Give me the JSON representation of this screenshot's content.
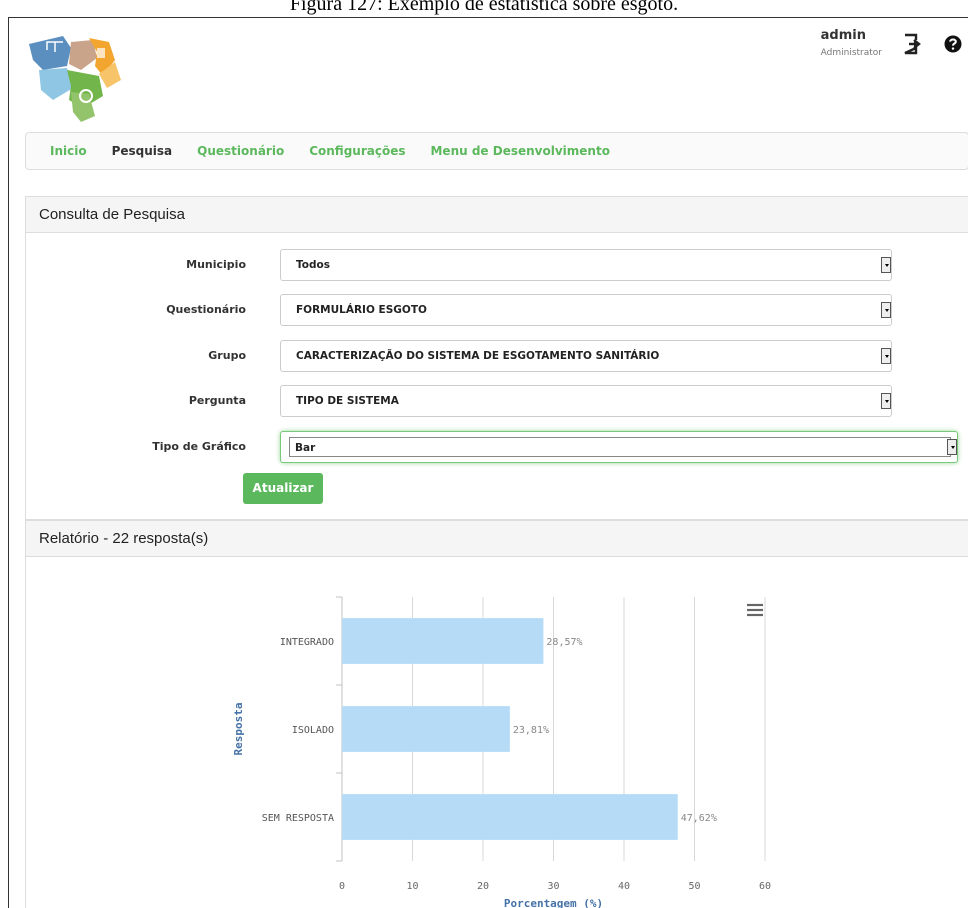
{
  "caption": "Figura 127: Exemplo de estatística sobre esgoto.",
  "header": {
    "user_name": "admin",
    "user_role": "Administrator",
    "icons": [
      "logo",
      "logout-icon",
      "help-icon"
    ]
  },
  "nav": {
    "items": [
      {
        "label": "Inicio",
        "active": false
      },
      {
        "label": "Pesquisa",
        "active": true
      },
      {
        "label": "Questionário",
        "active": false
      },
      {
        "label": "Configurações",
        "active": false
      },
      {
        "label": "Menu de Desenvolvimento",
        "active": false
      }
    ]
  },
  "query": {
    "title": "Consulta de Pesquisa",
    "fields": [
      {
        "label": "Municipio",
        "value": "Todos"
      },
      {
        "label": "Questionário",
        "value": "FORMULÁRIO ESGOTO"
      },
      {
        "label": "Grupo",
        "value": "CARACTERIZAÇÃO DO SISTEMA DE ESGOTAMENTO SANITÁRIO"
      },
      {
        "label": "Pergunta",
        "value": "TIPO DE SISTEMA"
      },
      {
        "label": "Tipo de Gráfico",
        "value": "Bar"
      }
    ],
    "update_label": "Atualizar"
  },
  "report": {
    "title": "Relatório - 22 resposta(s)"
  },
  "colors": {
    "accent": "#5cb85c",
    "bar": "#b5dbf7",
    "axis_title": "#4572a7"
  },
  "chart_data": {
    "type": "bar",
    "orientation": "horizontal",
    "categories": [
      "INTEGRADO",
      "ISOLADO",
      "SEM RESPOSTA"
    ],
    "values": [
      28.57,
      23.81,
      47.62
    ],
    "data_labels": [
      "28,57%",
      "23,81%",
      "47,62%"
    ],
    "xlabel": "Porcentagem (%)",
    "ylabel": "Resposta",
    "xlim": [
      0,
      60
    ],
    "xticks": [
      0,
      10,
      20,
      30,
      40,
      50,
      60
    ],
    "grid": true,
    "menu_icon": "hamburger-icon"
  }
}
